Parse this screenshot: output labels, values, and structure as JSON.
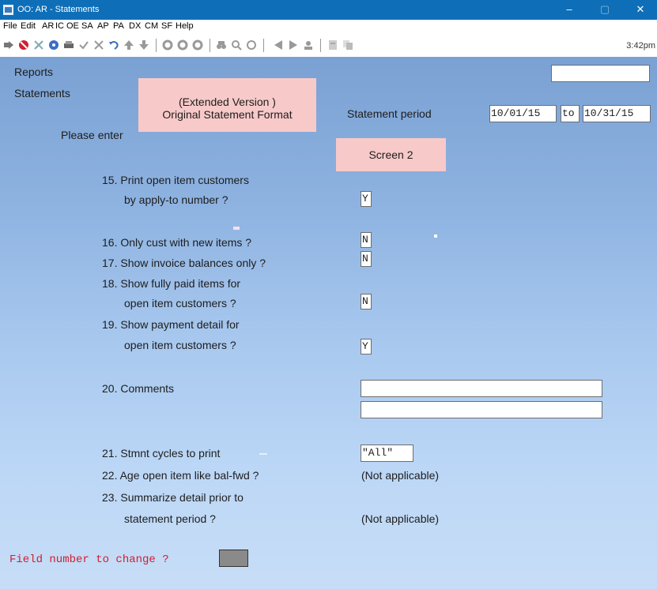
{
  "window": {
    "title": "OO: AR - Statements",
    "minimize": "–",
    "restore": "▢",
    "close": "✕"
  },
  "menu": [
    "File",
    "Edit",
    "AR",
    "IC",
    "OE",
    "SA",
    "AP",
    "PA",
    "DX",
    "CM",
    "SF",
    "Help"
  ],
  "toolbar": {
    "clock": "3:42pm"
  },
  "header": {
    "reports": "Reports",
    "statements": "Statements",
    "please_enter": "Please enter",
    "version_line1": "(Extended Version )",
    "version_line2": "Original Statement Format",
    "statement_period_label": "Statement period",
    "period_from": "10/01/15",
    "period_to_word": "to",
    "period_to": "10/31/15",
    "screen": "Screen 2"
  },
  "fields": {
    "f15_line1": "15. Print open item customers",
    "f15_line2": "by apply-to number ?",
    "f15_value": "Y",
    "f16_label": "16. Only cust with new items ?",
    "f16_value": "N",
    "f17_label": "17. Show invoice balances only ?",
    "f17_value": "N",
    "f18_line1": "18. Show fully paid items for",
    "f18_line2": "open item customers ?",
    "f18_value": "N",
    "f19_line1": "19. Show payment detail for",
    "f19_line2": "open item customers ?",
    "f19_value": "Y",
    "f20_label": "20. Comments",
    "f20_value1": "",
    "f20_value2": "",
    "f21_label": "21. Stmnt cycles to print",
    "f21_value": "\"All\"",
    "f22_label": "22. Age open item like bal-fwd ?",
    "f22_value": "(Not applicable)",
    "f23_line1": "23. Summarize detail prior to",
    "f23_line2": "statement period ?",
    "f23_value": "(Not applicable)"
  },
  "footer": {
    "prompt": "Field number to change ?"
  },
  "colors": {
    "titlebar": "#0e6fb8",
    "pink": "#f8c9c9",
    "prompt_red": "#d02030"
  }
}
